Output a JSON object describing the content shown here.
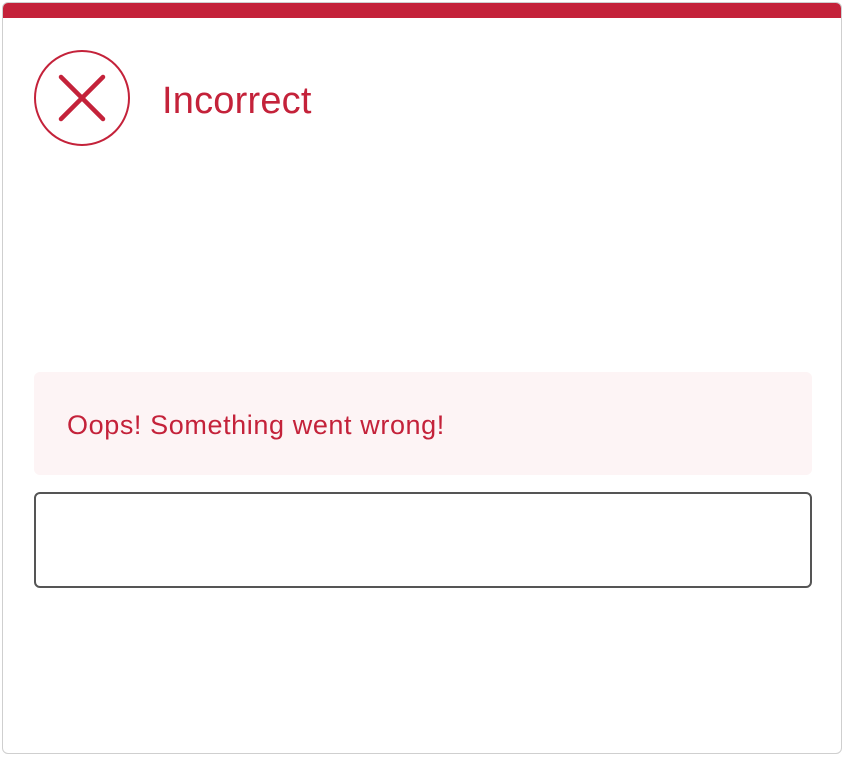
{
  "status": {
    "title": "Incorrect",
    "icon": "x-circle-icon",
    "color": "#c4223a"
  },
  "feedback": {
    "message": "Oops! Something went wrong!",
    "background": "#fdf4f5"
  },
  "answer": {
    "value": "",
    "placeholder": ""
  }
}
